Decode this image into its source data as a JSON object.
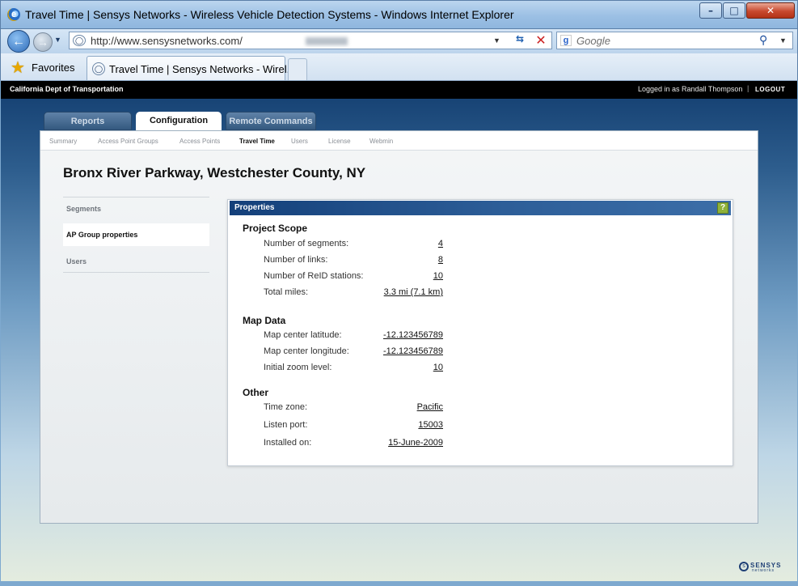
{
  "window": {
    "title": "Travel Time | Sensys Networks - Wireless Vehicle Detection Systems - Windows Internet Explorer",
    "min_glyph": "–",
    "max_glyph": "□",
    "close_glyph": "✕"
  },
  "browser": {
    "url": "http://www.sensysnetworks.com/",
    "search_placeholder": "Google",
    "favorites_label": "Favorites",
    "tab_label": "Travel Time | Sensys Networks - Wirel...",
    "back_glyph": "←",
    "forward_glyph": "→",
    "refresh_glyph": "⇆",
    "stop_glyph": "✕"
  },
  "app": {
    "org": "California Dept of Transportation",
    "logged_in": "Logged in as Randall Thompson",
    "logout": "LOGOUT",
    "main_tabs": [
      "Reports",
      "Configuration",
      "Remote Commands"
    ],
    "active_main_tab": "Configuration",
    "sub_tabs": [
      "Summary",
      "Access Point Groups",
      "Access Points",
      "Travel Time",
      "Users",
      "License",
      "Webmin"
    ],
    "active_sub_tab": "Travel Time",
    "page_title": "Bronx River Parkway, Westchester County, NY",
    "sidebar": [
      "Segments",
      "AP Group properties",
      "Users"
    ],
    "active_sidebar": "AP Group properties"
  },
  "properties": {
    "title": "Properties",
    "help": "?",
    "sections": [
      {
        "title": "Project Scope",
        "rows": [
          {
            "label": "Number of segments:",
            "value": "4"
          },
          {
            "label": "Number of links:",
            "value": "8"
          },
          {
            "label": "Number of ReID stations:",
            "value": "10"
          },
          {
            "label": "Total miles:",
            "value": "3.3 mi (7.1 km)"
          }
        ]
      },
      {
        "title": "Map Data",
        "rows": [
          {
            "label": "Map center latitude:",
            "value": "-12.123456789"
          },
          {
            "label": "Map center longitude:",
            "value": "-12.123456789"
          },
          {
            "label": "Initial zoom level:",
            "value": "10"
          }
        ]
      },
      {
        "title": "Other",
        "rows": [
          {
            "label": "Time zone:",
            "value": "Pacific"
          },
          {
            "label": "Listen port:",
            "value": "15003"
          },
          {
            "label": "Installed on:",
            "value": "15-June-2009"
          }
        ]
      }
    ]
  },
  "brand": {
    "name": "SENSYS",
    "sub": "networks"
  }
}
